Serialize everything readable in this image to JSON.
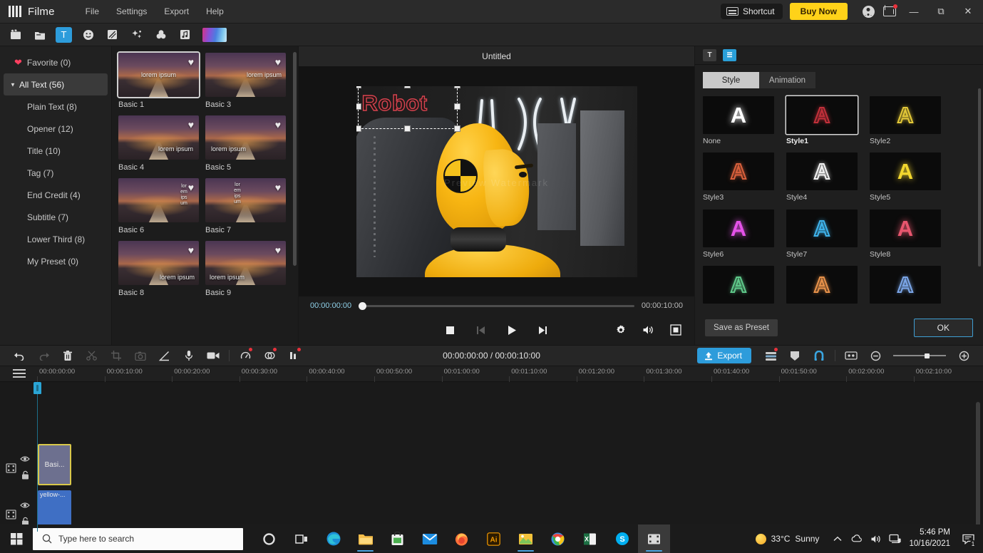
{
  "app": {
    "name": "Filme",
    "menu": [
      "File",
      "Settings",
      "Export",
      "Help"
    ],
    "shortcut_label": "Shortcut",
    "buy_label": "Buy Now"
  },
  "toolbar": {
    "items": [
      {
        "name": "media-icon",
        "glyph": "▣"
      },
      {
        "name": "folder-icon",
        "glyph": "▤"
      },
      {
        "name": "text-icon",
        "glyph": "T"
      },
      {
        "name": "sticker-icon",
        "glyph": "☺"
      },
      {
        "name": "transition-icon",
        "glyph": "◨"
      },
      {
        "name": "effects-icon",
        "glyph": "✦"
      },
      {
        "name": "filter-icon",
        "glyph": "✿"
      },
      {
        "name": "audio-icon",
        "glyph": "♫"
      }
    ]
  },
  "sidebar": {
    "items": [
      {
        "label": "Favorite (0)",
        "name": "sidebar-item-favorite"
      },
      {
        "label": "All Text (56)",
        "name": "sidebar-item-all-text"
      },
      {
        "label": "Plain Text (8)",
        "name": "sidebar-item-plain-text"
      },
      {
        "label": "Opener (12)",
        "name": "sidebar-item-opener"
      },
      {
        "label": "Title (10)",
        "name": "sidebar-item-title"
      },
      {
        "label": "Tag (7)",
        "name": "sidebar-item-tag"
      },
      {
        "label": "End Credit (4)",
        "name": "sidebar-item-end-credit"
      },
      {
        "label": "Subtitle (7)",
        "name": "sidebar-item-subtitle"
      },
      {
        "label": "Lower Third (8)",
        "name": "sidebar-item-lower-third"
      },
      {
        "label": "My Preset (0)",
        "name": "sidebar-item-my-preset"
      }
    ]
  },
  "templates": {
    "sample_text": "lorem ipsum",
    "items": [
      {
        "label": "Basic 1",
        "pos": "p-mid",
        "selected": true
      },
      {
        "label": "Basic 3",
        "pos": "p-midr",
        "selected": false
      },
      {
        "label": "Basic 4",
        "pos": "p-br",
        "selected": false
      },
      {
        "label": "Basic 5",
        "pos": "p-bl",
        "selected": false
      },
      {
        "label": "Basic 6",
        "pos": "p-vr",
        "selected": false
      },
      {
        "label": "Basic 7",
        "pos": "p-vl",
        "selected": false
      },
      {
        "label": "Basic 8",
        "pos": "p-brw",
        "selected": false
      },
      {
        "label": "Basic 9",
        "pos": "p-blw",
        "selected": false
      }
    ]
  },
  "preview": {
    "title": "Untitled",
    "overlay_text": "Robot",
    "current_time": "00:00:00:00",
    "total_time": "00:00:10:00",
    "watermark": "Preview Watermark"
  },
  "style_panel": {
    "tabs": [
      {
        "label": "Style",
        "active": true
      },
      {
        "label": "Animation",
        "active": false
      }
    ],
    "styles": [
      {
        "label": "None",
        "color": "#ffffff",
        "fill": true,
        "selected": false
      },
      {
        "label": "Style1",
        "color": "#c2303a",
        "fill": false,
        "selected": true
      },
      {
        "label": "Style2",
        "color": "#e3c838",
        "fill": false,
        "selected": false
      },
      {
        "label": "Style3",
        "color": "#d9603c",
        "fill": false,
        "selected": false
      },
      {
        "label": "Style4",
        "color": "#f2f2f2",
        "fill": false,
        "selected": false
      },
      {
        "label": "Style5",
        "color": "#f2d62e",
        "fill": true,
        "selected": false
      },
      {
        "label": "Style6",
        "color": "#e452e8",
        "fill": true,
        "selected": false
      },
      {
        "label": "Style7",
        "color": "#3fb4ec",
        "fill": false,
        "selected": false
      },
      {
        "label": "Style8",
        "color": "#e8566e",
        "fill": true,
        "selected": false
      },
      {
        "label": "",
        "color": "#5fc98a",
        "fill": false,
        "selected": false
      },
      {
        "label": "",
        "color": "#e8924a",
        "fill": false,
        "selected": false
      },
      {
        "label": "",
        "color": "#7ba6e8",
        "fill": false,
        "selected": false
      }
    ],
    "save_preset_label": "Save as Preset",
    "ok_label": "OK"
  },
  "timeline": {
    "time_display": "00:00:00:00 / 00:00:10:00",
    "export_label": "Export",
    "ruler_ticks": [
      "00:00:00:00",
      "00:00:10:00",
      "00:00:20:00",
      "00:00:30:00",
      "00:00:40:00",
      "00:00:50:00",
      "00:01:00:00",
      "00:01:10:00",
      "00:01:20:00",
      "00:01:30:00",
      "00:01:40:00",
      "00:01:50:00",
      "00:02:00:00",
      "00:02:10:00"
    ],
    "clips": [
      {
        "name": "text-clip",
        "label": "Basi..."
      },
      {
        "name": "video-clip",
        "label": "yellow-..."
      }
    ]
  },
  "taskbar": {
    "search_placeholder": "Type here to search",
    "weather_temp": "33°C",
    "weather_desc": "Sunny",
    "time": "5:46 PM",
    "date": "10/16/2021",
    "notif_count": "1"
  }
}
